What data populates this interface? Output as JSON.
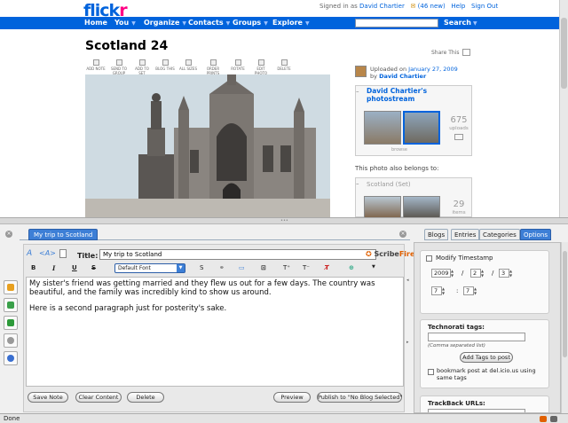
{
  "flickr": {
    "logo_a": "flick",
    "logo_b": "r",
    "signed_prefix": "Signed in as",
    "user": "David Chartier",
    "mail_count": "(46 new)",
    "help": "Help",
    "signout": "Sign Out",
    "nav": [
      "Home",
      "You",
      "Organize",
      "Contacts",
      "Groups",
      "Explore"
    ],
    "search_label": "Search",
    "page_title": "Scotland 24",
    "share": "Share This",
    "tools": [
      "ADD NOTE",
      "SEND TO GROUP",
      "ADD TO SET",
      "BLOG THIS",
      "ALL SIZES",
      "ORDER PRINTS",
      "ROTATE",
      "EDIT PHOTO",
      "DELETE"
    ],
    "uploaded_prefix": "Uploaded on",
    "uploaded_date": "January 27, 2009",
    "by_prefix": "by",
    "by_user": "David Chartier",
    "photostream_title": "David Chartier's photostream",
    "uploads_count": "675",
    "uploads_label": "uploads",
    "browse": "browse",
    "also_belongs": "This photo also belongs to:",
    "set_name": "Scotland (Set)",
    "set_count": "29",
    "set_label": "items"
  },
  "editor": {
    "tab": "My trip to Scotland",
    "title_label": "Title:",
    "title_value": "My trip to Scotland",
    "brand_a": "Scribe",
    "brand_b": "Fire",
    "format": [
      "B",
      "I",
      "U",
      "S"
    ],
    "font": "Default Font",
    "body": [
      "My sister's friend was getting married and they flew us out for a few days. The country was beautiful, and the family was incredibly kind to show us around.",
      "Here is a second paragraph just for posterity's sake."
    ],
    "save": "Save Note",
    "clear": "Clear Content",
    "delete": "Delete",
    "preview": "Preview",
    "publish": "Publish to \"No Blog Selected\""
  },
  "right": {
    "tabs": [
      "Blogs",
      "Entries",
      "Categories",
      "Options"
    ],
    "modify": "Modify Timestamp",
    "year": "2009",
    "month": "2",
    "day": "3",
    "hour": "7",
    "minute": "7",
    "slash": "/",
    "colon": ":",
    "tech_label": "Technorati tags:",
    "comma_note": "(Comma separated list)",
    "add_tags": "Add Tags to post",
    "delicious": "bookmark post at del.icio.us using same tags",
    "trackback_label": "TrackBack URLs:"
  },
  "status": "Done"
}
